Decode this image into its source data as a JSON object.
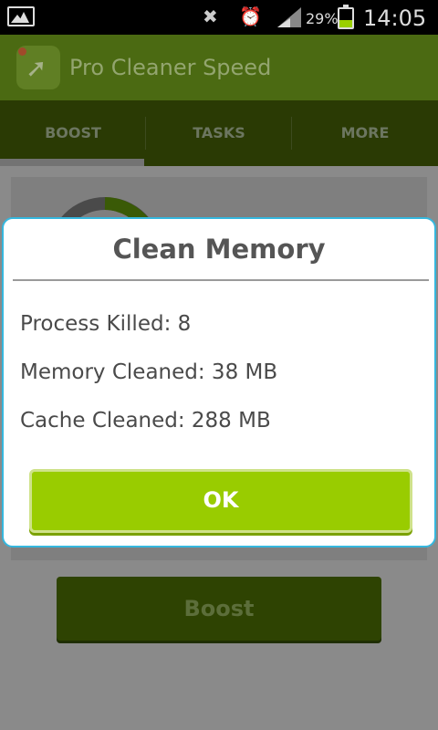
{
  "status_bar": {
    "battery_percent": "29%",
    "time": "14:05",
    "icons": [
      "gallery-icon",
      "mute-icon",
      "alarm-icon",
      "signal-icon",
      "battery-icon"
    ]
  },
  "app_bar": {
    "title": "Pro Cleaner Speed",
    "icon": "rocket-icon"
  },
  "tabs": [
    {
      "label": "BOOST",
      "selected": true
    },
    {
      "label": "TASKS",
      "selected": false
    },
    {
      "label": "MORE",
      "selected": false
    }
  ],
  "main": {
    "boost_label": "Boost"
  },
  "dialog": {
    "title": "Clean Memory",
    "lines": [
      "Process Killed: 8",
      "Memory Cleaned: 38 MB",
      "Cache Cleaned: 288 MB"
    ],
    "ok_label": "OK"
  },
  "colors": {
    "accent_green": "#99cc00",
    "dialog_border": "#35b7de",
    "appbar": "#4b6a12",
    "tabbar": "#2a3a04"
  }
}
